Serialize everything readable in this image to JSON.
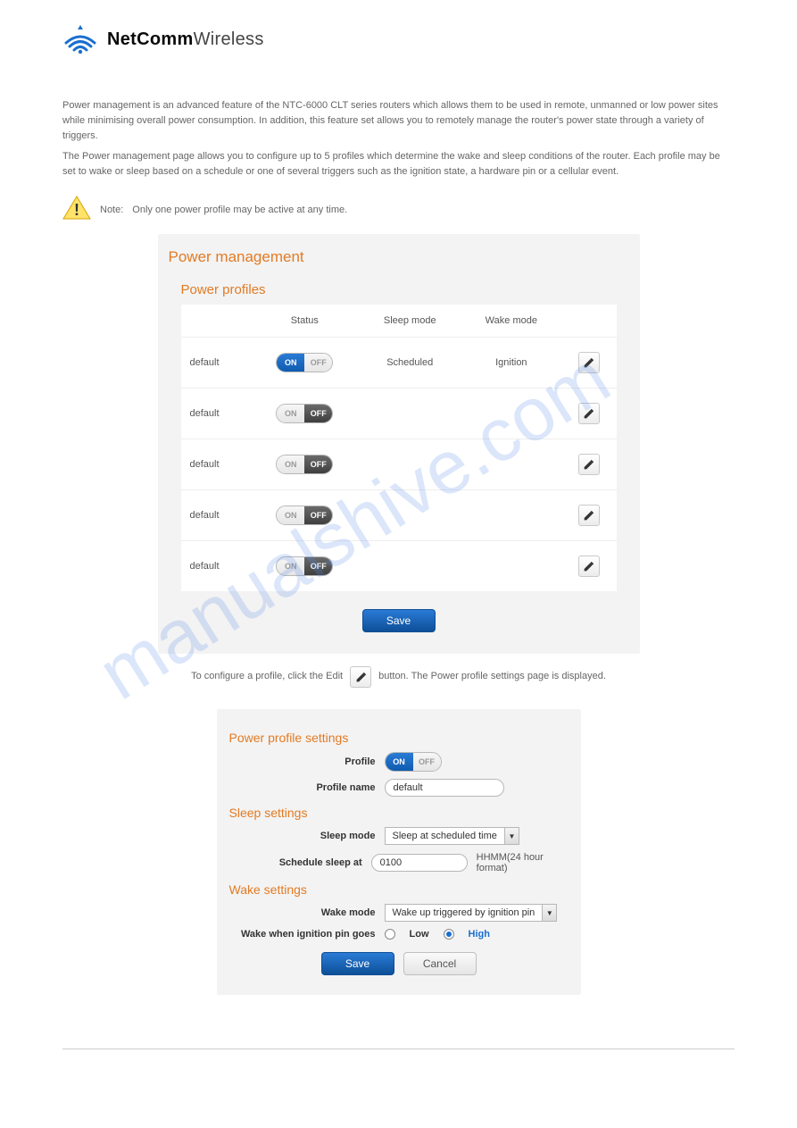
{
  "logo": {
    "brand_bold": "NetComm",
    "brand_light": "Wireless"
  },
  "header_right": "",
  "intro1": "Power management is an advanced feature of the NTC-6000 CLT series routers which allows them to be used in remote, unmanned or low power sites while minimising overall power consumption. In addition, this feature set allows you to remotely manage the router's power state through a variety of triggers.",
  "intro2": "The Power management page allows you to configure up to 5 profiles which determine the wake and sleep conditions of the router. Each profile may be set to wake or sleep based on a schedule or one of several triggers such as the ignition state, a hardware pin or a cellular event.",
  "note_label": "Note:",
  "note_text": "Only one power profile may be active at any time.",
  "panel1": {
    "title": "Power management",
    "subtitle": "Power profiles",
    "cols": {
      "name": "",
      "status": "Status",
      "sleep": "Sleep mode",
      "wake": "Wake mode",
      "edit": ""
    },
    "toggle_on": "ON",
    "toggle_off": "OFF",
    "rows": [
      {
        "name": "default",
        "on": true,
        "sleep": "Scheduled",
        "wake": "Ignition"
      },
      {
        "name": "default",
        "on": false,
        "sleep": "",
        "wake": ""
      },
      {
        "name": "default",
        "on": false,
        "sleep": "",
        "wake": ""
      },
      {
        "name": "default",
        "on": false,
        "sleep": "",
        "wake": ""
      },
      {
        "name": "default",
        "on": false,
        "sleep": "",
        "wake": ""
      }
    ],
    "save": "Save"
  },
  "instruction_before": "To configure a profile, click the Edit",
  "instruction_after": "button. The Power profile settings page is displayed.",
  "panel2": {
    "title": "Power profile settings",
    "profile_label": "Profile",
    "profile_name_label": "Profile name",
    "profile_name_value": "default",
    "sleep_title": "Sleep settings",
    "sleep_mode_label": "Sleep mode",
    "sleep_mode_value": "Sleep at scheduled time",
    "schedule_label": "Schedule sleep at",
    "schedule_value": "0100",
    "schedule_hint": "HHMM(24 hour format)",
    "wake_title": "Wake settings",
    "wake_mode_label": "Wake mode",
    "wake_mode_value": "Wake up triggered by ignition pin",
    "ignition_label": "Wake when ignition pin goes",
    "ignition_low": "Low",
    "ignition_high": "High",
    "save": "Save",
    "cancel": "Cancel"
  },
  "watermark": "manualshive.com",
  "footer_left": "",
  "footer_right": ""
}
